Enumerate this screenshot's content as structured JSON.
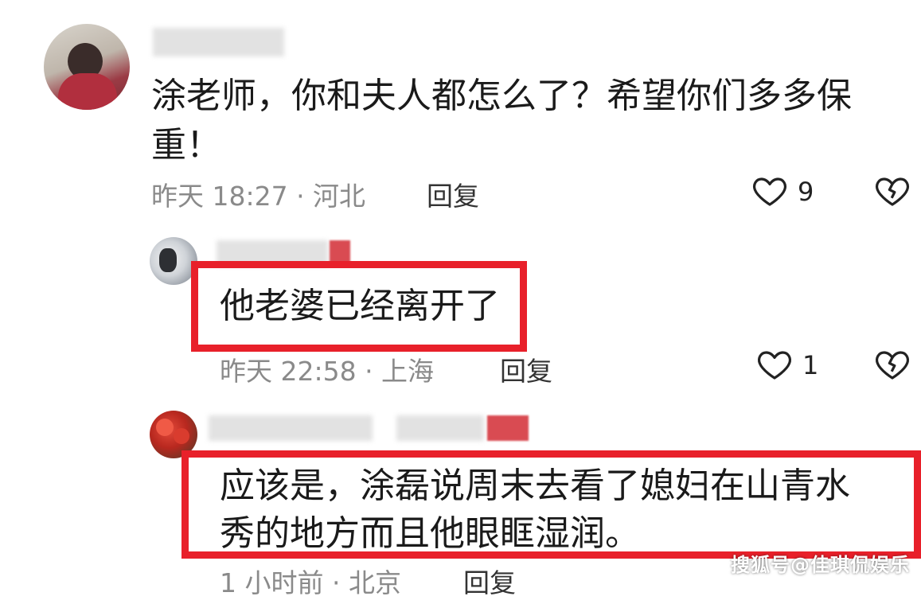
{
  "comments": [
    {
      "text_line1": "涂老师，你和夫人都怎么了？希望你们多多保",
      "text_line2": "重！",
      "meta": "昨天 18:27 · 河北",
      "reply_label": "回复",
      "likes": "9"
    },
    {
      "text": "他老婆已经离开了",
      "meta": "昨天 22:58 · 上海",
      "reply_label": "回复",
      "likes": "1"
    },
    {
      "text_line1": "应该是，涂磊说周末去看了媳妇在山青水",
      "text_line2": "秀的地方而且他眼眶湿润。",
      "meta": "1 小时前 · 北京",
      "reply_label": "回复"
    }
  ],
  "watermark": "搜狐号@佳琪侃娱乐",
  "colors": {
    "highlight": "#e8202a",
    "meta_text": "#8a8a8a"
  },
  "icons": {
    "like": "heart-outline-icon",
    "dislike": "broken-heart-icon"
  }
}
